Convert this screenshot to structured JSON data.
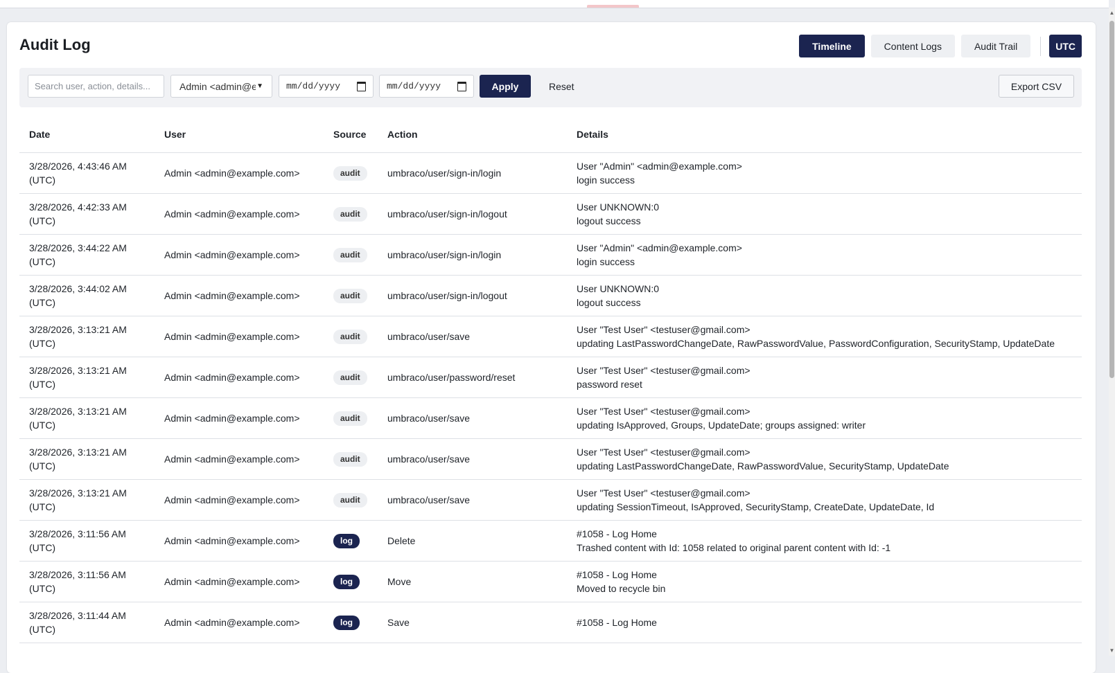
{
  "page": {
    "title": "Audit Log"
  },
  "view_tabs": [
    {
      "label": "Timeline",
      "active": true
    },
    {
      "label": "Content Logs",
      "active": false
    },
    {
      "label": "Audit Trail",
      "active": false
    }
  ],
  "timezone_button": "UTC",
  "filters": {
    "search_placeholder": "Search user, action, details...",
    "user_select_value": "Admin <admin@example.com>",
    "date_from_placeholder": "mm/dd/yyyy",
    "date_to_placeholder": "mm/dd/yyyy",
    "apply_label": "Apply",
    "reset_label": "Reset",
    "export_label": "Export CSV"
  },
  "table": {
    "columns": [
      "Date",
      "User",
      "Source",
      "Action",
      "Details"
    ],
    "rows": [
      {
        "date": "3/28/2026, 4:43:46 AM\n(UTC)",
        "user": "Admin <admin@example.com>",
        "source": "audit",
        "action": "umbraco/user/sign-in/login",
        "details": "User \"Admin\" <admin@example.com>\nlogin success"
      },
      {
        "date": "3/28/2026, 4:42:33 AM\n(UTC)",
        "user": "Admin <admin@example.com>",
        "source": "audit",
        "action": "umbraco/user/sign-in/logout",
        "details": "User UNKNOWN:0\nlogout success"
      },
      {
        "date": "3/28/2026, 3:44:22 AM\n(UTC)",
        "user": "Admin <admin@example.com>",
        "source": "audit",
        "action": "umbraco/user/sign-in/login",
        "details": "User \"Admin\" <admin@example.com>\nlogin success"
      },
      {
        "date": "3/28/2026, 3:44:02 AM\n(UTC)",
        "user": "Admin <admin@example.com>",
        "source": "audit",
        "action": "umbraco/user/sign-in/logout",
        "details": "User UNKNOWN:0\nlogout success"
      },
      {
        "date": "3/28/2026, 3:13:21 AM\n(UTC)",
        "user": "Admin <admin@example.com>",
        "source": "audit",
        "action": "umbraco/user/save",
        "details": "User \"Test User\" <testuser@gmail.com>\nupdating LastPasswordChangeDate, RawPasswordValue, PasswordConfiguration, SecurityStamp, UpdateDate"
      },
      {
        "date": "3/28/2026, 3:13:21 AM\n(UTC)",
        "user": "Admin <admin@example.com>",
        "source": "audit",
        "action": "umbraco/user/password/reset",
        "details": "User \"Test User\" <testuser@gmail.com>\npassword reset"
      },
      {
        "date": "3/28/2026, 3:13:21 AM\n(UTC)",
        "user": "Admin <admin@example.com>",
        "source": "audit",
        "action": "umbraco/user/save",
        "details": "User \"Test User\" <testuser@gmail.com>\nupdating IsApproved, Groups, UpdateDate; groups assigned: writer"
      },
      {
        "date": "3/28/2026, 3:13:21 AM\n(UTC)",
        "user": "Admin <admin@example.com>",
        "source": "audit",
        "action": "umbraco/user/save",
        "details": "User \"Test User\" <testuser@gmail.com>\nupdating LastPasswordChangeDate, RawPasswordValue, SecurityStamp, UpdateDate"
      },
      {
        "date": "3/28/2026, 3:13:21 AM\n(UTC)",
        "user": "Admin <admin@example.com>",
        "source": "audit",
        "action": "umbraco/user/save",
        "details": "User \"Test User\" <testuser@gmail.com>\nupdating SessionTimeout, IsApproved, SecurityStamp, CreateDate, UpdateDate, Id"
      },
      {
        "date": "3/28/2026, 3:11:56 AM\n(UTC)",
        "user": "Admin <admin@example.com>",
        "source": "log",
        "action": "Delete",
        "details": "#1058 - Log Home\nTrashed content with Id: 1058 related to original parent content with Id: -1"
      },
      {
        "date": "3/28/2026, 3:11:56 AM\n(UTC)",
        "user": "Admin <admin@example.com>",
        "source": "log",
        "action": "Move",
        "details": "#1058 - Log Home\nMoved to recycle bin"
      },
      {
        "date": "3/28/2026, 3:11:44 AM\n(UTC)",
        "user": "Admin <admin@example.com>",
        "source": "log",
        "action": "Save",
        "details": "#1058 - Log Home"
      }
    ]
  },
  "icons": {
    "dropdown": "chevron-down-icon",
    "calendar": "calendar-icon"
  }
}
